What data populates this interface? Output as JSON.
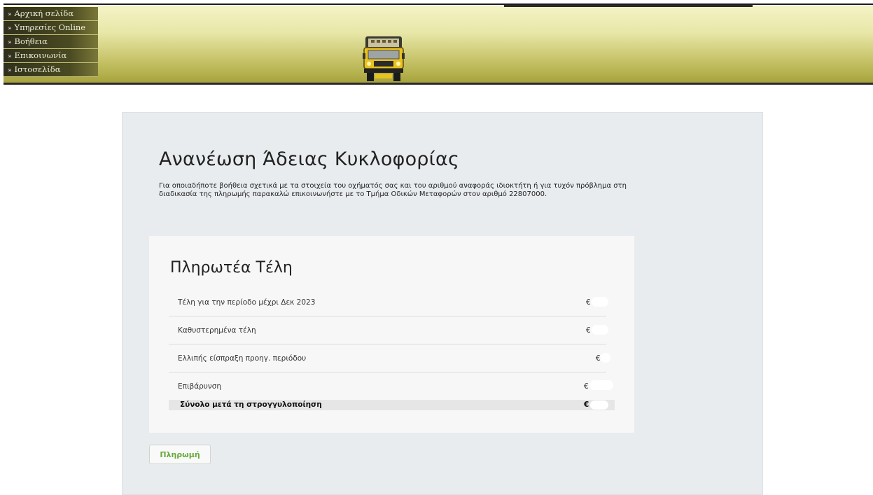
{
  "nav": {
    "items": [
      {
        "label": "Αρχική σελίδα"
      },
      {
        "label": "Υπηρεσίες Online"
      },
      {
        "label": "Βοήθεια"
      },
      {
        "label": "Επικοινωνία"
      },
      {
        "label": "Ιστοσελίδα"
      }
    ],
    "arrow": "»"
  },
  "main": {
    "title": "Ανανέωση Άδειας Κυκλοφορίας",
    "description": "Για οποιαδήποτε βοήθεια σχετικά με τα στοιχεία του οχήματός σας και του αριθμού αναφοράς ιδιοκτήτη ή για τυχόν πρόβλημα στη διαδικασία της πληρωμής παρακαλώ επικοινωνήστε με το Τμήμα Οδικών Μεταφορών στον αριθμό 22807000."
  },
  "fees": {
    "title": "Πληρωτέα Τέλη",
    "currency": "€",
    "rows": [
      {
        "label": "Τέλη για την περίοδο μέχρι Δεκ 2023"
      },
      {
        "label": "Καθυστερημένα τέλη"
      },
      {
        "label": "Ελλιπής είσπραξη προηγ. περιόδου"
      },
      {
        "label": "Επιβάρυνση"
      }
    ],
    "total_label": "Σύνολο μετά τη στρογγυλοποίηση"
  },
  "actions": {
    "pay_label": "Πληρωμή"
  },
  "colors": {
    "header_top": "#f4f3c6",
    "header_bottom": "#a7a43d",
    "panel_bg": "#e9ecef",
    "pay_text": "#6aa93c"
  }
}
